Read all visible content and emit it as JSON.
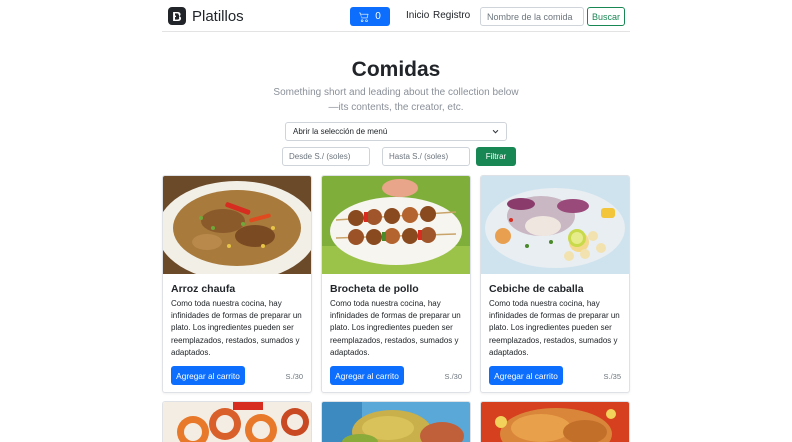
{
  "navbar": {
    "brand_letter": "B",
    "brand": "Platillos",
    "cart_count": "0",
    "links": [
      "Inicio",
      "Registro"
    ],
    "search_placeholder": "Nombre de la comida",
    "search_button": "Buscar"
  },
  "header": {
    "title": "Comidas",
    "lead": "Something short and leading about the collection below—its contents, the creator, etc."
  },
  "filters": {
    "menu_select": "Abrir la selección de menú",
    "from_placeholder": "Desde S./ (soles)",
    "to_placeholder": "Hasta S./ (soles)",
    "filter_button": "Filtrar"
  },
  "cards": [
    {
      "title": "Arroz chaufa",
      "text": "Como toda nuestra cocina, hay infinidades de formas de preparar un plato. Los ingredientes pueden ser reemplazados, restados, sumados y adaptados.",
      "button": "Agregar al carrito",
      "price": "S./30"
    },
    {
      "title": "Brocheta de pollo",
      "text": "Como toda nuestra cocina, hay infinidades de formas de preparar un plato. Los ingredientes pueden ser reemplazados, restados, sumados y adaptados.",
      "button": "Agregar al carrito",
      "price": "S./30"
    },
    {
      "title": "Cebiche de caballa",
      "text": "Como toda nuestra cocina, hay infinidades de formas de preparar un plato. Los ingredientes pueden ser reemplazados, restados, sumados y adaptados.",
      "button": "Agregar al carrito",
      "price": "S./35"
    }
  ],
  "colors": {
    "primary": "#0d6efd",
    "success": "#198754",
    "text": "#212529",
    "muted": "#6c757d"
  }
}
